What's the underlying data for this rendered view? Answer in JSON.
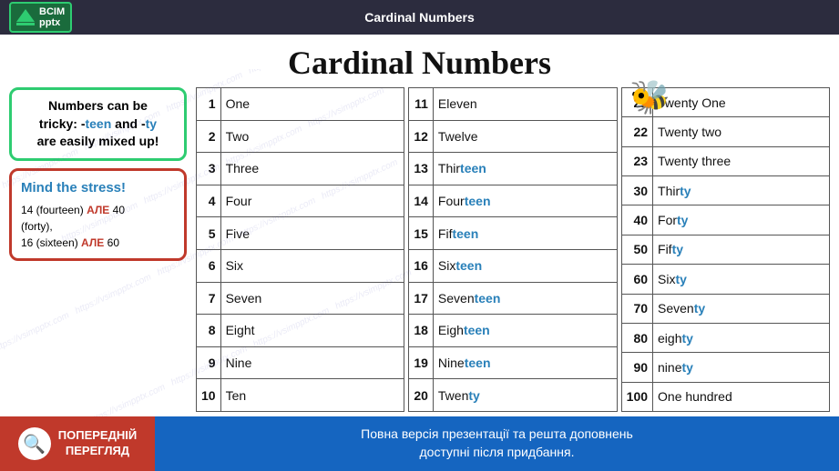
{
  "topbar": {
    "title": "Cardinal Numbers",
    "logo_line1": "BCIM",
    "logo_line2": "pptx"
  },
  "page": {
    "title": "Cardinal Numbers"
  },
  "tip_box": {
    "line1": "Numbers can be",
    "line2_pre": "tricky: -",
    "teen": "teen",
    "line2_mid": " and -",
    "ty": "ty",
    "line3": "are easily mixed up!"
  },
  "stress_box": {
    "title": "Mind the stress!",
    "line1": "14 (fourteen)",
    "ale1": "АЛЕ",
    "line1b": "40",
    "line2": "(forty),",
    "line3": "16 (sixteen)",
    "ale2": "АЛЕ",
    "line3b": "60"
  },
  "table1": {
    "rows": [
      {
        "num": "1",
        "word": "One"
      },
      {
        "num": "2",
        "word": "Two"
      },
      {
        "num": "3",
        "word": "Three"
      },
      {
        "num": "4",
        "word": "Four"
      },
      {
        "num": "5",
        "word": "Five"
      },
      {
        "num": "6",
        "word": "Six"
      },
      {
        "num": "7",
        "word": "Seven"
      },
      {
        "num": "8",
        "word": "Eight"
      },
      {
        "num": "9",
        "word": "Nine"
      },
      {
        "num": "10",
        "word": "Ten"
      }
    ]
  },
  "table2": {
    "rows": [
      {
        "num": "11",
        "word": "Eleven",
        "highlight": ""
      },
      {
        "num": "12",
        "word": "Twelve",
        "highlight": ""
      },
      {
        "num": "13",
        "word_pre": "Thir",
        "teen": "teen",
        "highlight": "teen"
      },
      {
        "num": "14",
        "word_pre": "Four",
        "teen": "teen",
        "highlight": "teen"
      },
      {
        "num": "15",
        "word_pre": "Fif",
        "teen": "teen",
        "highlight": "teen"
      },
      {
        "num": "16",
        "word_pre": "Six",
        "teen": "teen",
        "highlight": "teen"
      },
      {
        "num": "17",
        "word_pre": "Seven",
        "teen": "teen",
        "highlight": "teen"
      },
      {
        "num": "18",
        "word_pre": "Eigh",
        "teen": "teen",
        "highlight": "teen"
      },
      {
        "num": "19",
        "word_pre": "Nine",
        "teen": "teen",
        "highlight": "teen"
      },
      {
        "num": "20",
        "word": "Twenty",
        "highlight": ""
      }
    ]
  },
  "table3": {
    "rows": [
      {
        "num": "21",
        "word": "Twenty One",
        "highlight": ""
      },
      {
        "num": "22",
        "word": "Twenty two",
        "highlight": ""
      },
      {
        "num": "23",
        "word": "Twenty three",
        "highlight": ""
      },
      {
        "num": "30",
        "word_pre": "Thir",
        "ty": "ty",
        "highlight": "ty"
      },
      {
        "num": "40",
        "word_pre": "For",
        "ty": "ty",
        "highlight": "ty"
      },
      {
        "num": "50",
        "word_pre": "Fif",
        "ty": "ty",
        "highlight": "ty"
      },
      {
        "num": "60",
        "word_pre": "Six",
        "ty": "ty",
        "highlight": "ty"
      },
      {
        "num": "70",
        "word_pre": "Seven",
        "ty": "ty",
        "highlight": "ty"
      },
      {
        "num": "80",
        "word_pre": "eigh",
        "ty": "ty",
        "highlight": "ty"
      },
      {
        "num": "90",
        "word_pre": "nine",
        "ty": "ty",
        "highlight": "ty"
      },
      {
        "num": "100",
        "word": "One hundred",
        "highlight": ""
      }
    ]
  },
  "bottom": {
    "preview_line1": "ПОПЕРЕДНІЙ",
    "preview_line2": "ПЕРЕГЛЯД",
    "message_line1": "Повна версія презентації та решта доповнень",
    "message_line2": "доступні після придбання."
  }
}
